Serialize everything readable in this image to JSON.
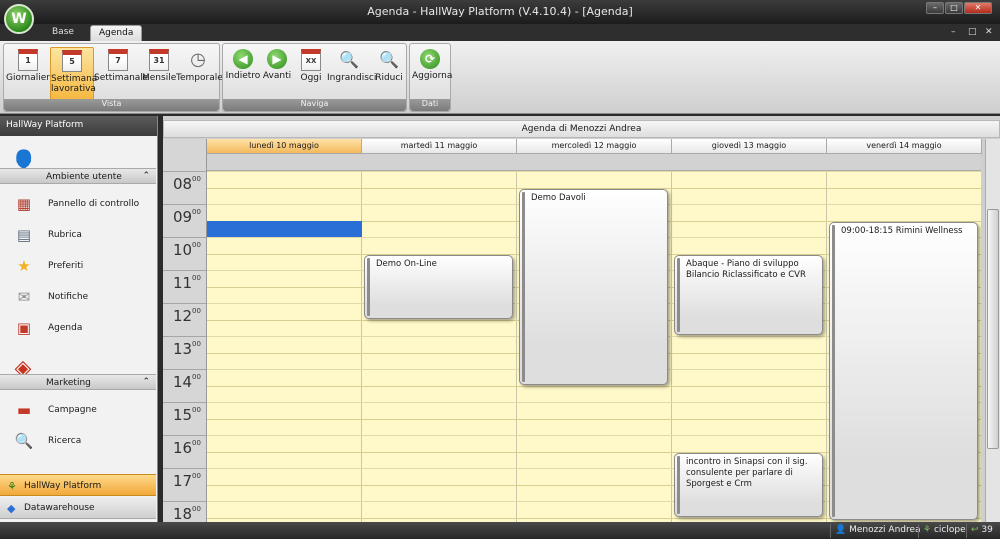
{
  "window": {
    "title": "Agenda - HallWay Platform (V.4.10.4) - [Agenda]",
    "logo_glyph": "W",
    "min_glyph": "–",
    "max_glyph": "□",
    "close_glyph": "✕"
  },
  "ribbon_tabs": [
    "Base",
    "Agenda"
  ],
  "mdi_controls": [
    "–",
    "□",
    "✕"
  ],
  "ribbon": {
    "groups": {
      "vista": "Vista",
      "naviga": "Naviga",
      "dati": "Dati"
    },
    "buttons": {
      "giornaliera": {
        "label": "Giornaliera",
        "icon": "1"
      },
      "settimana_lavorativa": {
        "label1": "Settimana",
        "label2": "lavorativa",
        "icon": "5"
      },
      "settimanale": {
        "label": "Settimanale",
        "icon": "7"
      },
      "mensile": {
        "label": "Mensile",
        "icon": "31"
      },
      "temporale": {
        "label": "Temporale",
        "icon": "◷"
      },
      "indietro": {
        "label": "Indietro",
        "icon": "◀"
      },
      "avanti": {
        "label": "Avanti",
        "icon": "▶"
      },
      "oggi": {
        "label": "Oggi",
        "icon": "XX"
      },
      "ingrandisci": {
        "label": "Ingrandisci",
        "icon": "🔍"
      },
      "riduci": {
        "label": "Riduci",
        "icon": "🔍"
      },
      "aggiorna": {
        "label": "Aggiorna",
        "icon": "⟳"
      }
    },
    "active_button": "settimana_lavorativa"
  },
  "nav": {
    "header": "HallWay Platform",
    "sections": [
      {
        "label": "Ambiente utente",
        "icon": "👤",
        "chevron": "⌃",
        "items": [
          {
            "label": "Pannello di controllo",
            "icon": "▦"
          },
          {
            "label": "Rubrica",
            "icon": "▤"
          },
          {
            "label": "Preferiti",
            "icon": "★"
          },
          {
            "label": "Notifiche",
            "icon": "✉"
          },
          {
            "label": "Agenda",
            "icon": "▣"
          }
        ]
      },
      {
        "label": "Marketing",
        "icon": "◈",
        "chevron": "⌃",
        "items": [
          {
            "label": "Campagne",
            "icon": "▬"
          },
          {
            "label": "Ricerca",
            "icon": "🔍"
          }
        ]
      }
    ],
    "bottom": [
      {
        "label": "HallWay Platform",
        "icon": "⚘",
        "active": true
      },
      {
        "label": "Datawarehouse",
        "icon": "◆",
        "active": false
      }
    ]
  },
  "calendar": {
    "title": "Agenda di Menozzi Andrea",
    "days": [
      {
        "label": "lunedì 10 maggio",
        "today": true
      },
      {
        "label": "martedì 11 maggio",
        "today": false
      },
      {
        "label": "mercoledì 12 maggio",
        "today": false
      },
      {
        "label": "giovedì 13 maggio",
        "today": false
      },
      {
        "label": "venerdì 14 maggio",
        "today": false
      }
    ],
    "hours": [
      {
        "h": "08",
        "m": "00"
      },
      {
        "h": "09",
        "m": "00"
      },
      {
        "h": "10",
        "m": "00"
      },
      {
        "h": "11",
        "m": "00"
      },
      {
        "h": "12",
        "m": "00"
      },
      {
        "h": "13",
        "m": "00"
      },
      {
        "h": "14",
        "m": "00"
      },
      {
        "h": "15",
        "m": "00"
      },
      {
        "h": "16",
        "m": "00"
      },
      {
        "h": "17",
        "m": "00"
      },
      {
        "h": "18",
        "m": "00"
      }
    ],
    "events": [
      {
        "day": 1,
        "start": 10.0,
        "end": 12.0,
        "text": "Demo On-Line"
      },
      {
        "day": 2,
        "start": 8.0,
        "end": 14.0,
        "text": "Demo Davoli"
      },
      {
        "day": 3,
        "start": 10.0,
        "end": 12.5,
        "text": "Abaque - Piano di sviluppo Bilancio Riclassificato e CVR"
      },
      {
        "day": 3,
        "start": 16.0,
        "end": 18.0,
        "text": "incontro in Sinapsi con il sig. consulente  per parlare  di Sporgest e Crm"
      },
      {
        "day": 4,
        "start": 9.0,
        "end": 18.25,
        "text": "09:00-18:15 Rimini Wellness"
      }
    ],
    "selected_slot": {
      "day": 0,
      "start": 9.0,
      "end": 9.5
    }
  },
  "status": {
    "user": "Menozzi Andrea",
    "user_icon": "👤",
    "server": "ciclope",
    "server_icon": "⚘",
    "count": "39",
    "count_icon": "↩"
  }
}
